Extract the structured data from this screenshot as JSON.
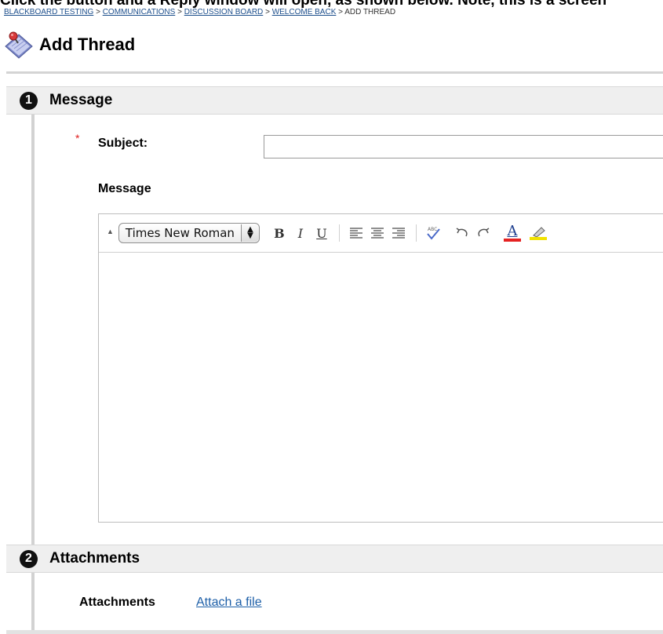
{
  "top_clipped_text": "Click the button and a Reply window will open, as shown below. Note, this is a screen ",
  "breadcrumb": {
    "items": [
      "BLACKBOARD TESTING",
      "COMMUNICATIONS",
      "DISCUSSION BOARD",
      "WELCOME BACK"
    ],
    "separator": ">",
    "current": "ADD THREAD"
  },
  "page_title": "Add Thread",
  "sections": [
    {
      "step": "1",
      "title": "Message"
    },
    {
      "step": "2",
      "title": "Attachments"
    }
  ],
  "form": {
    "required_marker": "*",
    "subject_label": "Subject:",
    "subject_value": "",
    "message_label": "Message"
  },
  "editor": {
    "font_family_value": "Times New Roman",
    "toolbar": {
      "bold": "B",
      "italic": "I",
      "underline": "U"
    }
  },
  "attachments": {
    "label": "Attachments",
    "link_text": "Attach a file"
  },
  "colors": {
    "link": "#1d4f8c",
    "required": "#e02020",
    "text_color_underline": "#e52222",
    "highlight_underline": "#f2e200"
  }
}
